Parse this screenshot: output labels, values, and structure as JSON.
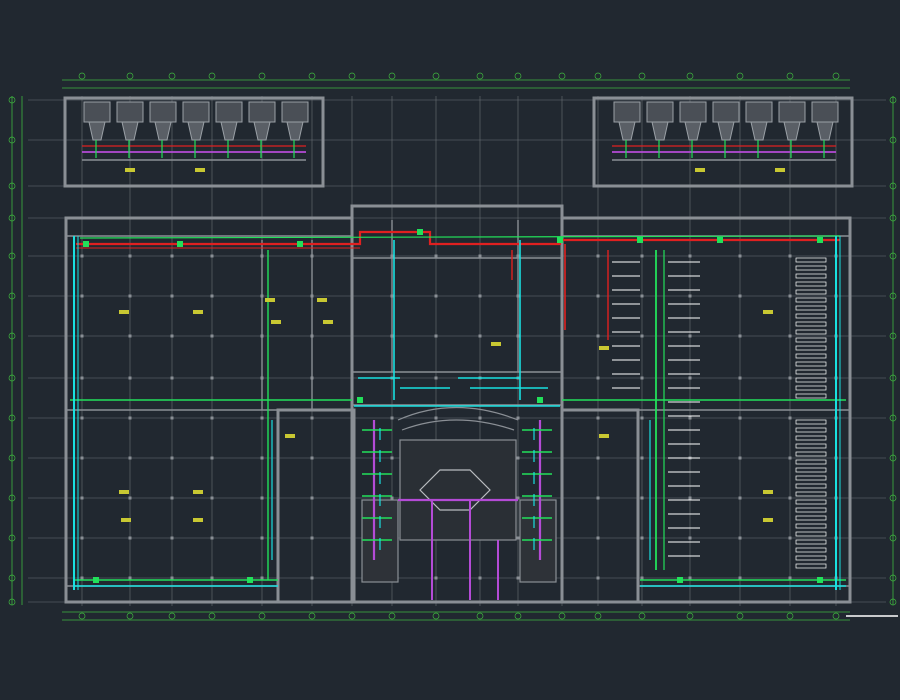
{
  "drawing": {
    "title": "",
    "colors": {
      "background": "#212830",
      "wall": "#8a8f95",
      "grid": "#6b7076",
      "dimension": "#3fb63f",
      "hot_pipe": "#e02020",
      "cold_pipe": "#19e0e0",
      "drain_pipe": "#b44bd6",
      "branch_pipe": "#22e05a",
      "annotation": "#c8c832",
      "label": "#ffffff"
    },
    "icons": [
      "grid-bubble-icon",
      "fixture-icon",
      "valve-icon",
      "riser-icon"
    ]
  }
}
